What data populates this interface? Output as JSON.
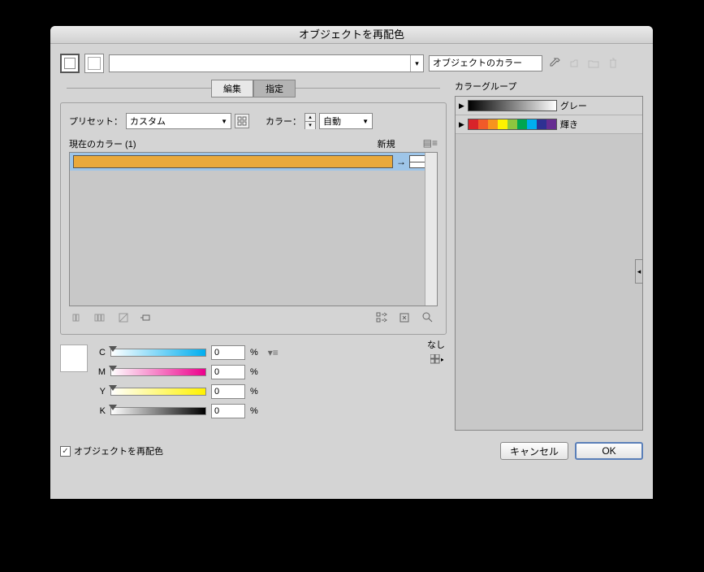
{
  "title": "オブジェクトを再配色",
  "top": {
    "object_color_label": "オブジェクトのカラー"
  },
  "tabs": {
    "edit": "編集",
    "assign": "指定"
  },
  "preset": {
    "label": "プリセット：",
    "value": "カスタム",
    "color_label": "カラー：",
    "color_value": "自動"
  },
  "colorlist": {
    "current_label": "現在のカラー (1)",
    "new_label": "新規",
    "none_label": "なし"
  },
  "cmyk": {
    "c": {
      "label": "C",
      "value": "0",
      "pct": "%"
    },
    "m": {
      "label": "M",
      "value": "0",
      "pct": "%"
    },
    "y": {
      "label": "Y",
      "value": "0",
      "pct": "%"
    },
    "k": {
      "label": "K",
      "value": "0",
      "pct": "%"
    }
  },
  "groups": {
    "title": "カラーグループ",
    "items": [
      {
        "name": "グレー"
      },
      {
        "name": "輝き"
      }
    ]
  },
  "rainbow": [
    "#d8232a",
    "#f15a29",
    "#f7941e",
    "#fff200",
    "#8dc63f",
    "#00a651",
    "#00aeef",
    "#2e3192",
    "#662d91"
  ],
  "bottom": {
    "recolor_label": "オブジェクトを再配色",
    "cancel": "キャンセル",
    "ok": "OK"
  }
}
